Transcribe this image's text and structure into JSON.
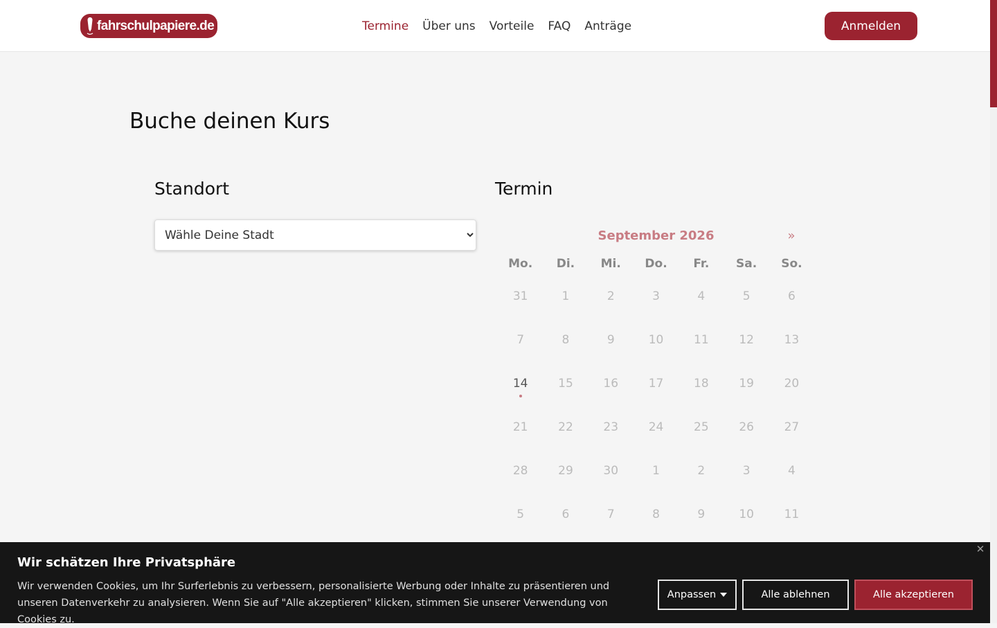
{
  "header": {
    "logo_text": "fahrschulpapiere.de",
    "logo_icon": "pen-icon",
    "nav": [
      {
        "label": "Termine",
        "active": true
      },
      {
        "label": "Über uns",
        "active": false
      },
      {
        "label": "Vorteile",
        "active": false
      },
      {
        "label": "FAQ",
        "active": false
      },
      {
        "label": "Anträge",
        "active": false
      }
    ],
    "login_label": "Anmelden"
  },
  "main": {
    "title": "Buche deinen Kurs",
    "location": {
      "title": "Standort",
      "select_value": "Wähle Deine Stadt"
    },
    "appointment": {
      "title": "Termin",
      "calendar": {
        "month": "September 2026",
        "next_label": "»",
        "weekdays": [
          "Mo.",
          "Di.",
          "Mi.",
          "Do.",
          "Fr.",
          "Sa.",
          "So."
        ],
        "weeks": [
          [
            "31",
            "1",
            "2",
            "3",
            "4",
            "5",
            "6"
          ],
          [
            "7",
            "8",
            "9",
            "10",
            "11",
            "12",
            "13"
          ],
          [
            "14",
            "15",
            "16",
            "17",
            "18",
            "19",
            "20"
          ],
          [
            "21",
            "22",
            "23",
            "24",
            "25",
            "26",
            "27"
          ],
          [
            "28",
            "29",
            "30",
            "1",
            "2",
            "3",
            "4"
          ],
          [
            "5",
            "6",
            "7",
            "8",
            "9",
            "10",
            "11"
          ]
        ],
        "available_days": [
          "14"
        ]
      }
    }
  },
  "cookie_banner": {
    "title": "Wir schätzen Ihre Privatsphäre",
    "text": "Wir verwenden Cookies, um Ihr Surferlebnis zu verbessern, personalisierte Werbung oder Inhalte zu präsentieren und unseren Datenverkehr zu analysieren. Wenn Sie auf \"Alle akzeptieren\" klicken, stimmen Sie unserer Verwendung von Cookies zu.",
    "close_label": "✕",
    "customize_label": "Anpassen",
    "reject_label": "Alle ablehnen",
    "accept_label": "Alle akzeptieren"
  },
  "colors": {
    "brand": "#9b2330",
    "brand_light": "#c87c83",
    "page_bg": "#f5f5f5",
    "banner_bg": "#161616"
  }
}
